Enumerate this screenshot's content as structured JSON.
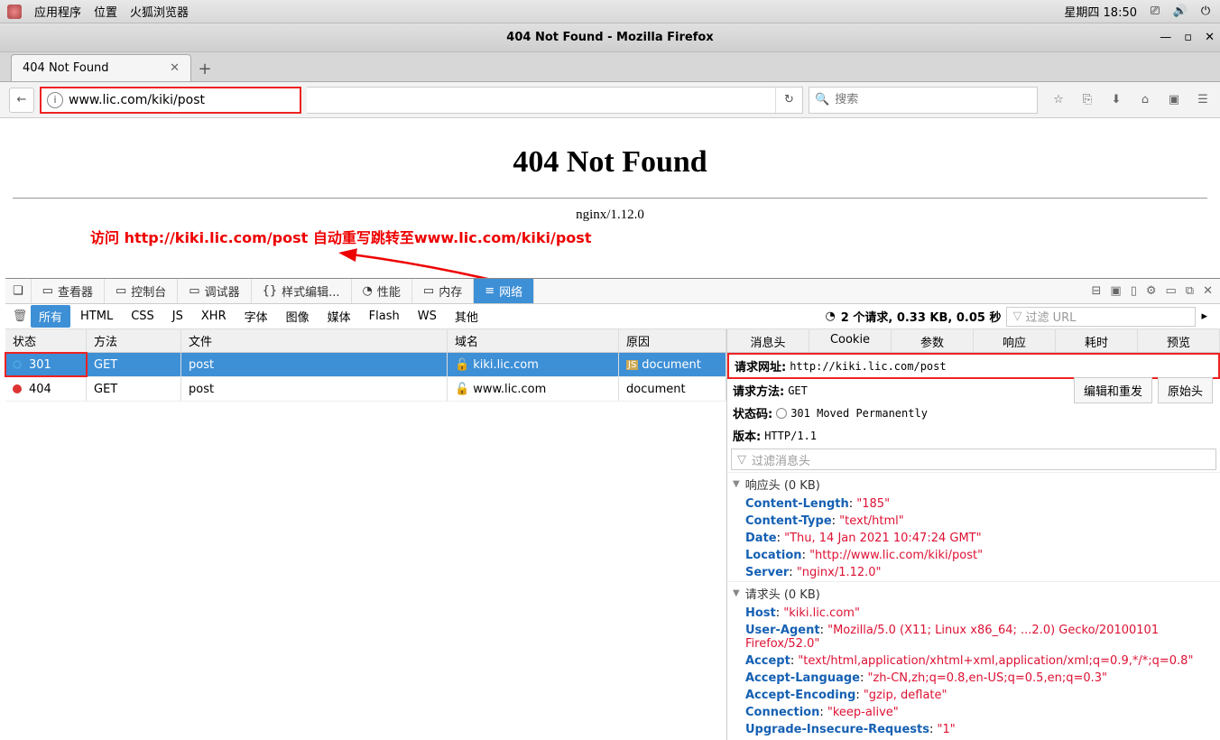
{
  "os": {
    "apps": "应用程序",
    "places": "位置",
    "firefox": "火狐浏览器",
    "clock": "星期四 18:50"
  },
  "window": {
    "title": "404 Not Found - Mozilla Firefox"
  },
  "tab": {
    "title": "404 Not Found"
  },
  "nav": {
    "url": "www.lic.com/kiki/post",
    "search_placeholder": "搜索"
  },
  "page": {
    "h1": "404 Not Found",
    "server": "nginx/1.12.0",
    "annotation": "访问 http://kiki.lic.com/post 自动重写跳转至www.lic.com/kiki/post"
  },
  "devtools": {
    "tabs": [
      "查看器",
      "控制台",
      "调试器",
      "样式编辑...",
      "性能",
      "内存",
      "网络"
    ],
    "filters": [
      "所有",
      "HTML",
      "CSS",
      "JS",
      "XHR",
      "字体",
      "图像",
      "媒体",
      "Flash",
      "WS",
      "其他"
    ],
    "summary": "2 个请求, 0.33 KB, 0.05 秒",
    "filter_url_placeholder": "过滤 URL",
    "columns": [
      "状态",
      "方法",
      "文件",
      "域名",
      "原因"
    ],
    "rows": [
      {
        "status": "301",
        "method": "GET",
        "file": "post",
        "domain": "kiki.lic.com",
        "cause": "document",
        "js": true,
        "sel": true
      },
      {
        "status": "404",
        "method": "GET",
        "file": "post",
        "domain": "www.lic.com",
        "cause": "document",
        "js": false,
        "sel": false
      }
    ],
    "detail_tabs": [
      "消息头",
      "Cookie",
      "参数",
      "响应",
      "耗时",
      "预览"
    ],
    "req_url_label": "请求网址:",
    "req_url_value": "http://kiki.lic.com/post",
    "req_method_label": "请求方法:",
    "req_method_value": "GET",
    "status_code_label": "状态码:",
    "status_code_value": "301 Moved Permanently",
    "version_label": "版本:",
    "version_value": "HTTP/1.1",
    "btn_edit": "编辑和重发",
    "btn_raw": "原始头",
    "filter_headers": "过滤消息头",
    "response_headers_label": "响应头 (0 KB)",
    "request_headers_label": "请求头 (0 KB)",
    "response_headers": [
      {
        "k": "Content-Length",
        "v": "\"185\""
      },
      {
        "k": "Content-Type",
        "v": "\"text/html\""
      },
      {
        "k": "Date",
        "v": "\"Thu, 14 Jan 2021 10:47:24 GMT\""
      },
      {
        "k": "Location",
        "v": "\"http://www.lic.com/kiki/post\""
      },
      {
        "k": "Server",
        "v": "\"nginx/1.12.0\""
      }
    ],
    "request_headers": [
      {
        "k": "Host",
        "v": "\"kiki.lic.com\""
      },
      {
        "k": "User-Agent",
        "v": "\"Mozilla/5.0 (X11; Linux x86_64; ...2.0) Gecko/20100101 Firefox/52.0\""
      },
      {
        "k": "Accept",
        "v": "\"text/html,application/xhtml+xml,application/xml;q=0.9,*/*;q=0.8\""
      },
      {
        "k": "Accept-Language",
        "v": "\"zh-CN,zh;q=0.8,en-US;q=0.5,en;q=0.3\""
      },
      {
        "k": "Accept-Encoding",
        "v": "\"gzip, deflate\""
      },
      {
        "k": "Connection",
        "v": "\"keep-alive\""
      },
      {
        "k": "Upgrade-Insecure-Requests",
        "v": "\"1\""
      }
    ]
  }
}
